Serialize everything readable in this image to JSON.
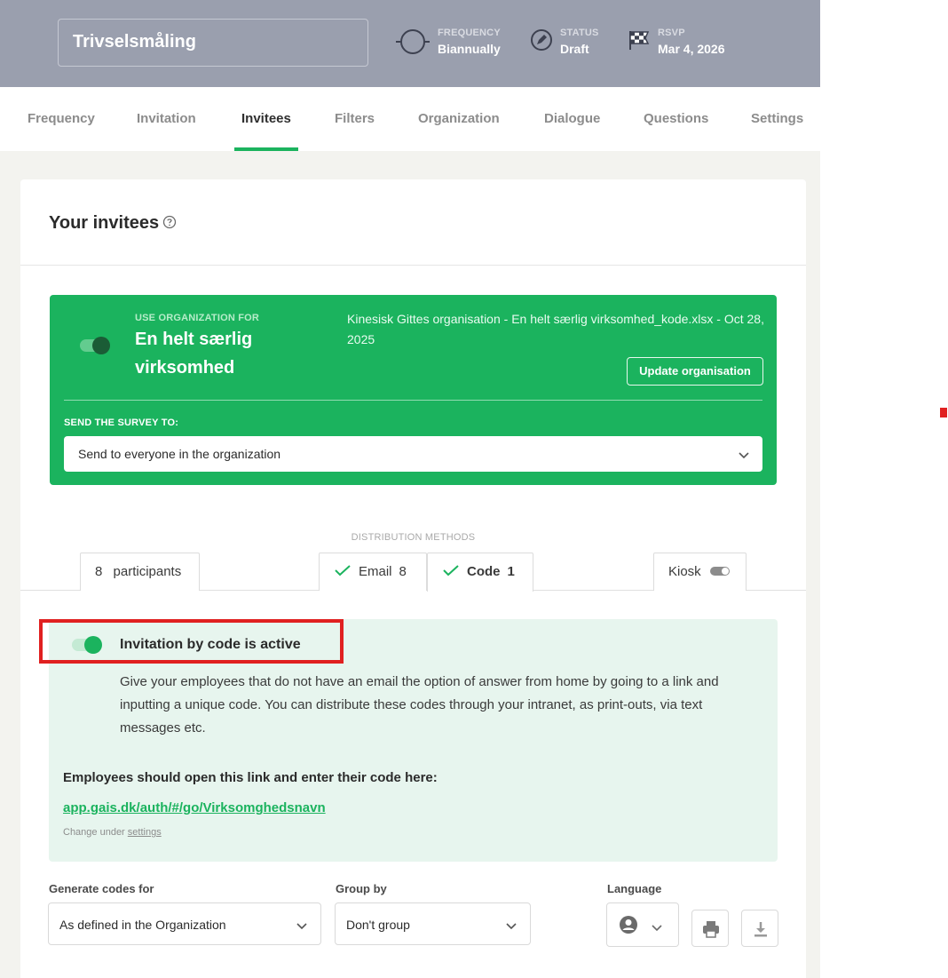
{
  "header": {
    "survey_title": "Trivselsmåling",
    "frequency": {
      "label": "FREQUENCY",
      "value": "Biannually",
      "icon": "cycle-icon"
    },
    "status": {
      "label": "STATUS",
      "value": "Draft",
      "icon": "edit-circle-icon"
    },
    "rsvp": {
      "label": "RSVP",
      "value": "Mar 4, 2026",
      "icon": "checkered-flag-icon"
    }
  },
  "tabs": [
    {
      "label": "Frequency"
    },
    {
      "label": "Invitation"
    },
    {
      "label": "Invitees",
      "active": true
    },
    {
      "label": "Filters"
    },
    {
      "label": "Organization"
    },
    {
      "label": "Dialogue"
    },
    {
      "label": "Questions"
    },
    {
      "label": "Settings"
    }
  ],
  "card": {
    "title": "Your invitees"
  },
  "organization": {
    "use_label": "USE ORGANIZATION FOR",
    "name": "En helt særlig virksomhed",
    "file_info": "Kinesisk Gittes organisation - En helt særlig virksomhed_kode.xlsx - Oct 28, 2025",
    "update_button": "Update organisation",
    "send_label": "SEND THE SURVEY TO:",
    "send_value": "Send to everyone in the organization",
    "enabled": true
  },
  "distribution": {
    "label": "DISTRIBUTION METHODS",
    "participants": {
      "count": "8",
      "label": "participants"
    },
    "email": {
      "label": "Email",
      "count": "8"
    },
    "code": {
      "label": "Code",
      "count": "1"
    },
    "kiosk": {
      "label": "Kiosk"
    }
  },
  "code_panel": {
    "active_label": "Invitation by code is active",
    "description": "Give your employees that do not have an email the option of answer from home by going to a link and inputting a unique code. You can distribute these codes through your intranet, as print-outs, via text messages etc.",
    "open_link_text": "Employees should open this link and enter their code here:",
    "link": "app.gais.dk/auth/#/go/Virksomghedsnavn",
    "change_prefix": "Change under",
    "change_link": "settings"
  },
  "filters": {
    "generate_label": "Generate codes for",
    "generate_value": "As defined in the Organization",
    "group_label": "Group by",
    "group_value": "Don't group",
    "language_label": "Language"
  },
  "colors": {
    "accent": "#1bb35e",
    "header_bg": "#9a9fae",
    "highlight": "#e02020"
  }
}
